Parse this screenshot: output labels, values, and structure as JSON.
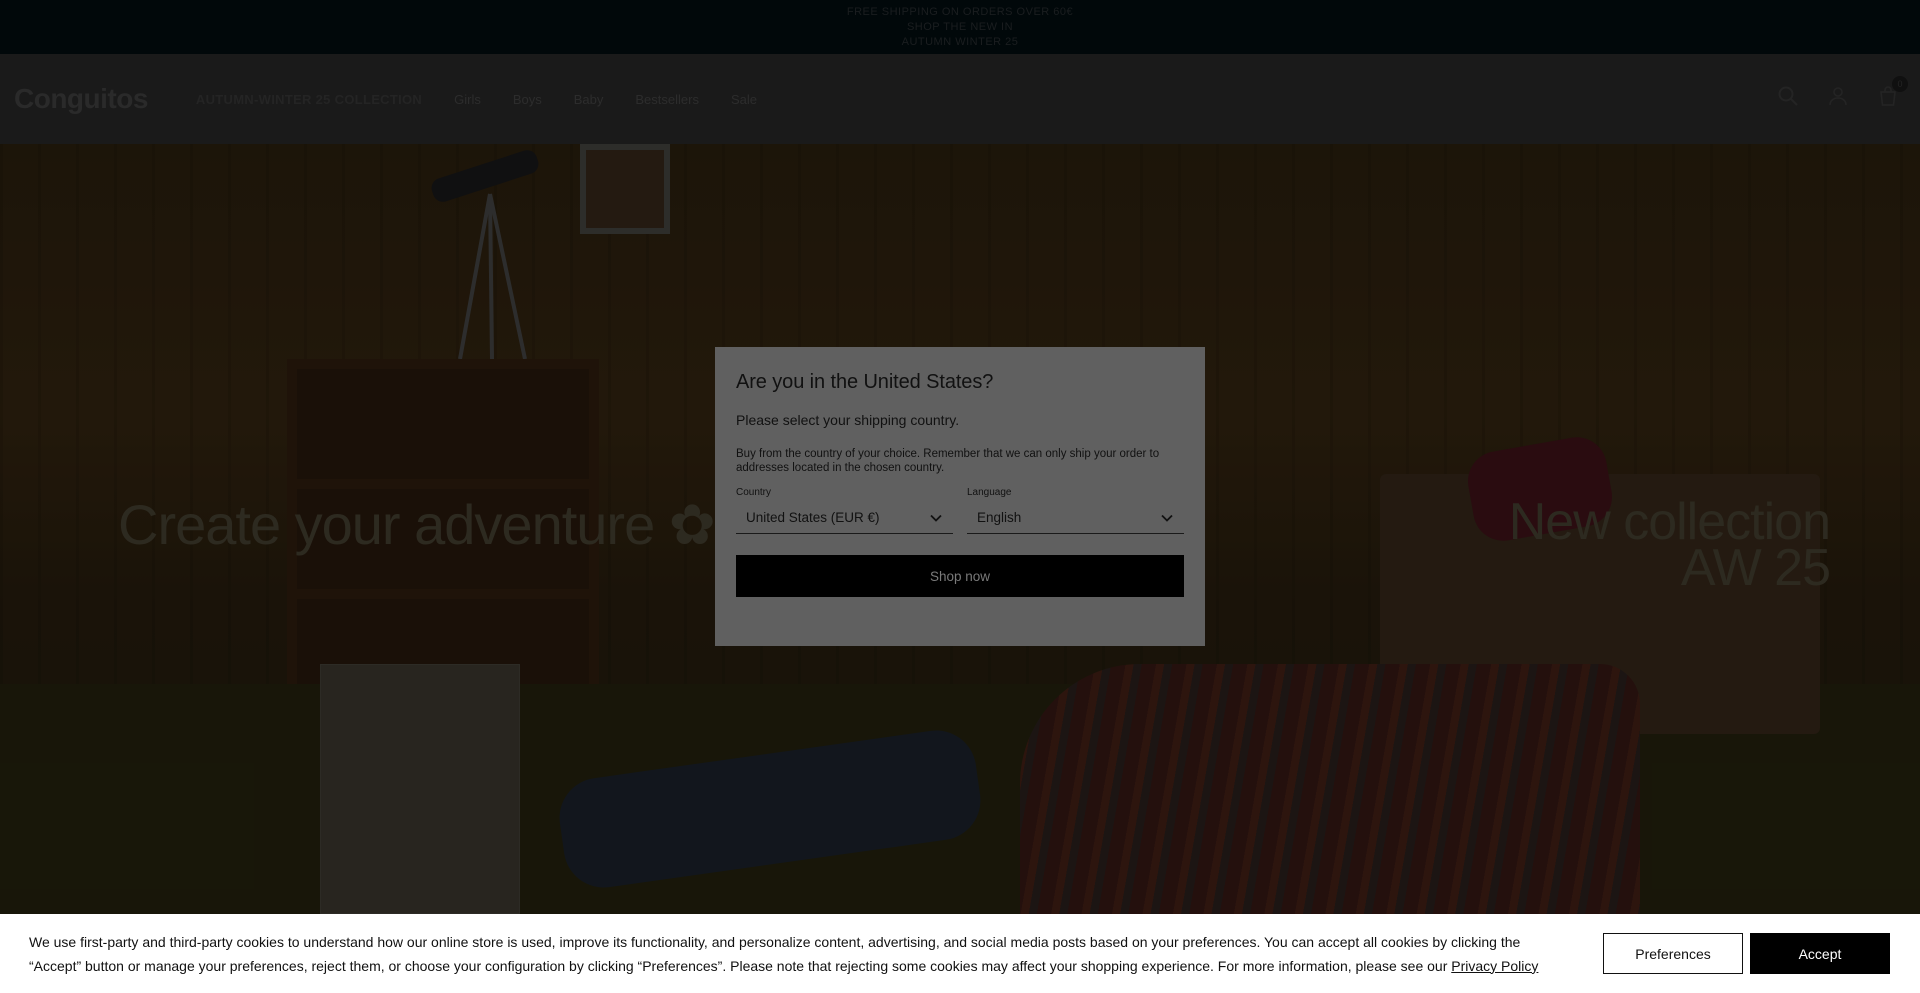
{
  "announcement": {
    "lines": [
      "FREE SHIPPING ON ORDERS OVER 60€",
      "SHOP THE NEW IN",
      "AUTUMN WINTER 25"
    ]
  },
  "header": {
    "logo": "Conguitos",
    "nav": [
      {
        "label": "AUTUMN-WINTER 25 COLLECTION",
        "promo": true
      },
      {
        "label": "Girls",
        "promo": false
      },
      {
        "label": "Boys",
        "promo": false
      },
      {
        "label": "Baby",
        "promo": false
      },
      {
        "label": "Bestsellers",
        "promo": false
      },
      {
        "label": "Sale",
        "promo": false
      }
    ],
    "cart_count": "0"
  },
  "hero": {
    "left_title": "Create your adventure ✿",
    "right_title_line1": "New collection",
    "right_title_line2": "AW 25"
  },
  "modal": {
    "title": "Are you in the United States?",
    "subtitle": "Please select your shipping country.",
    "description": "Buy from the country of your choice. Remember that we can only ship your order to addresses located in the chosen country.",
    "country_label": "Country",
    "country_value": "United States (EUR €)",
    "language_label": "Language",
    "language_value": "English",
    "shop_button": "Shop now"
  },
  "cookie": {
    "text": "We use first-party and third-party cookies to understand how our online store is used, improve its functionality, and personalize content, advertising, and social media posts based on your preferences. You can accept all cookies by clicking the “Accept” button or manage your preferences, reject them, or choose your configuration by clicking “Preferences”. Please note that rejecting some cookies may affect your shopping experience. For more information, please see our",
    "link": "Privacy Policy",
    "preferences_button": "Preferences",
    "accept_button": "Accept"
  }
}
